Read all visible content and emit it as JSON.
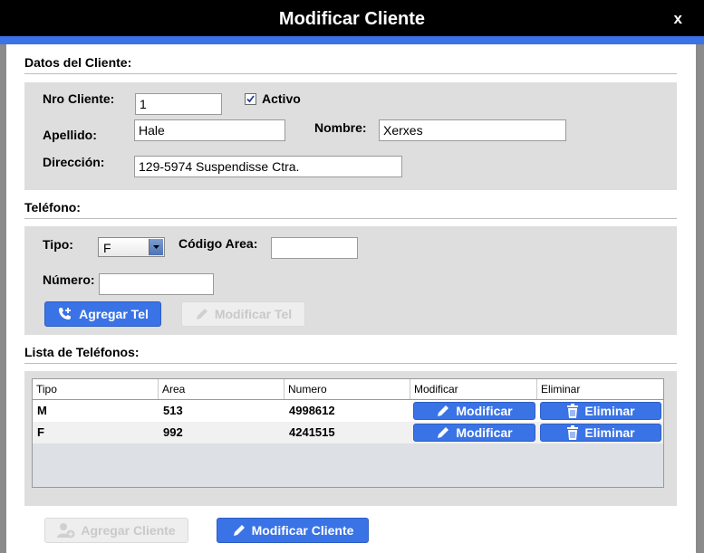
{
  "window": {
    "title": "Modificar Cliente",
    "close_label": "x"
  },
  "colors": {
    "accent": "#3a73e6",
    "panel": "#dedede",
    "titlebar": "#000000"
  },
  "client_section": {
    "heading": "Datos del Cliente:",
    "nro_label": "Nro Cliente:",
    "nro_value": "1",
    "activo_label": "Activo",
    "activo_checked": true,
    "apellido_label": "Apellido:",
    "apellido_value": "Hale",
    "nombre_label": "Nombre:",
    "nombre_value": "Xerxes",
    "direccion_label": "Dirección:",
    "direccion_value": "129-5974 Suspendisse Ctra."
  },
  "phone_section": {
    "heading": "Teléfono:",
    "tipo_label": "Tipo:",
    "tipo_value": "F",
    "codigo_label": "Código Area:",
    "codigo_value": "",
    "numero_label": "Número:",
    "numero_value": "",
    "add_button": "Agregar Tel",
    "modify_button": "Modificar Tel"
  },
  "phone_list": {
    "heading": "Lista de Teléfonos:",
    "columns": [
      "Tipo",
      "Area",
      "Numero",
      "Modificar",
      "Eliminar"
    ],
    "rows": [
      {
        "tipo": "M",
        "area": "513",
        "numero": "4998612",
        "modificar": "Modificar",
        "eliminar": "Eliminar"
      },
      {
        "tipo": "F",
        "area": "992",
        "numero": "4241515",
        "modificar": "Modificar",
        "eliminar": "Eliminar"
      }
    ]
  },
  "footer": {
    "add_client_button": "Agregar Cliente",
    "modify_client_button": "Modificar Cliente"
  },
  "icons": {
    "close": "close-icon",
    "checkbox": "checkmark-icon",
    "dropdown": "chevron-down-icon",
    "add_phone": "phone-plus-icon",
    "edit": "pencil-icon",
    "delete": "trash-icon",
    "add_user": "user-plus-icon"
  }
}
